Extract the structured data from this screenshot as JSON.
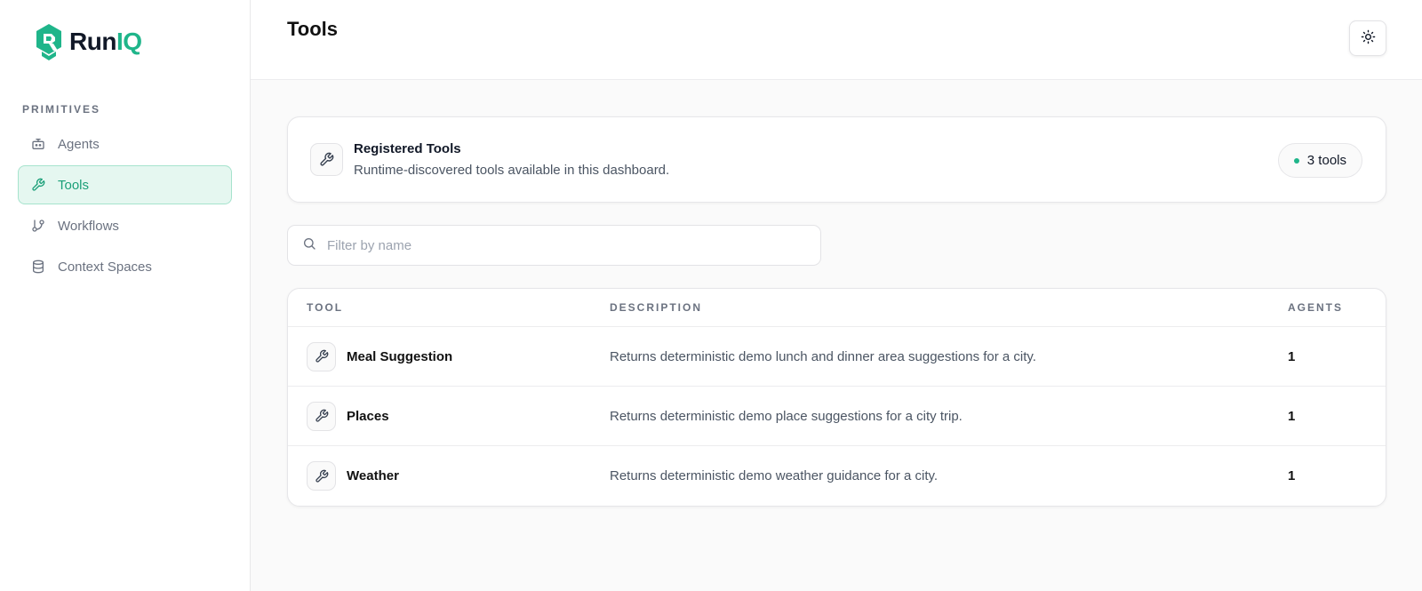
{
  "brand": {
    "name_part1": "Run",
    "name_part2": "IQ",
    "accent": "#1fb58a"
  },
  "sidebar": {
    "section_label": "PRIMITIVES",
    "items": [
      {
        "label": "Agents",
        "icon": "bot-icon",
        "active": false
      },
      {
        "label": "Tools",
        "icon": "wrench-icon",
        "active": true
      },
      {
        "label": "Workflows",
        "icon": "git-branch-icon",
        "active": false
      },
      {
        "label": "Context Spaces",
        "icon": "database-icon",
        "active": false
      }
    ]
  },
  "header": {
    "title": "Tools",
    "theme_toggle_icon": "sun-icon"
  },
  "summary": {
    "title": "Registered Tools",
    "subtitle": "Runtime-discovered tools available in this dashboard.",
    "count_label": "3 tools",
    "icon": "wrench-icon"
  },
  "search": {
    "placeholder": "Filter by name",
    "value": ""
  },
  "table": {
    "headers": {
      "tool": "TOOL",
      "description": "DESCRIPTION",
      "agents": "AGENTS"
    },
    "rows": [
      {
        "name": "Meal Suggestion",
        "description": "Returns deterministic demo lunch and dinner area suggestions for a city.",
        "agents": "1"
      },
      {
        "name": "Places",
        "description": "Returns deterministic demo place suggestions for a city trip.",
        "agents": "1"
      },
      {
        "name": "Weather",
        "description": "Returns deterministic demo weather guidance for a city.",
        "agents": "1"
      }
    ]
  }
}
